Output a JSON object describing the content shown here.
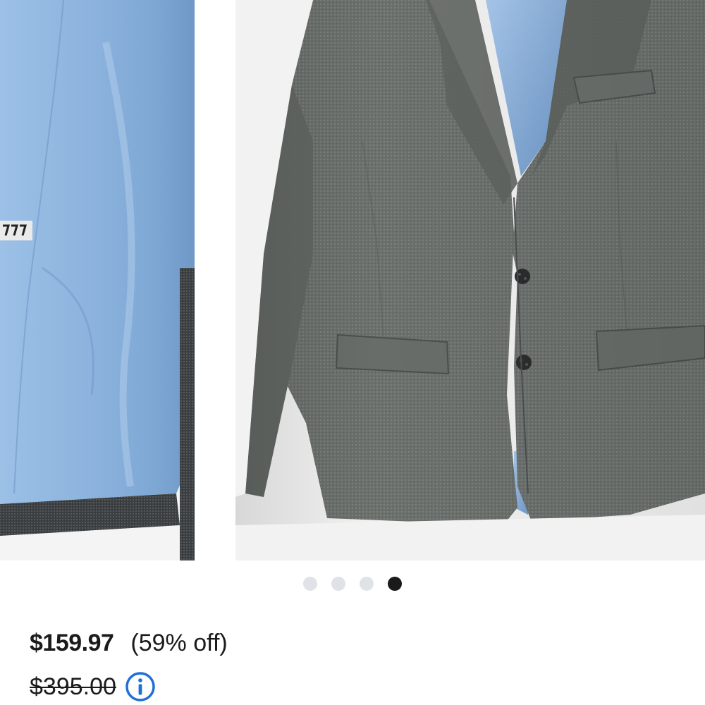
{
  "carousel": {
    "images": [
      {
        "icon": "jacket-lining-closeup-image"
      },
      {
        "icon": "grey-suit-jacket-image"
      }
    ],
    "dots": [
      {
        "active": false
      },
      {
        "active": false
      },
      {
        "active": false
      },
      {
        "active": true
      }
    ]
  },
  "pricing": {
    "sale_price": "$159.97",
    "discount": "(59% off)",
    "original_price": "$395.00",
    "info_icon": "info-icon"
  },
  "colors": {
    "lining_blue": "#8fb4dc",
    "jacket_grey": "#6f7370",
    "info_blue": "#1f6fd6",
    "active_dot": "#1a1a1a",
    "inactive_dot": "#dfe3e8"
  }
}
